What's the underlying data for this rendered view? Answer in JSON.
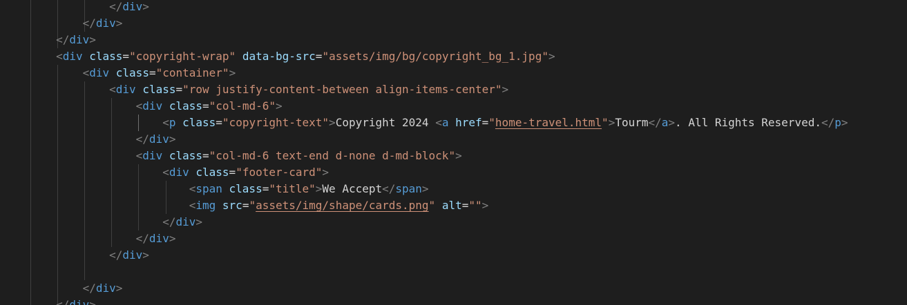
{
  "editor": {
    "theme_colors": {
      "background": "#1e1e1e",
      "tag_bracket": "#808080",
      "tag_name": "#569cd6",
      "attribute": "#9cdcfe",
      "string": "#ce9178",
      "text": "#d4d4d4"
    },
    "lines": [
      {
        "indent": "            ",
        "text": "</div>"
      },
      {
        "indent": "        ",
        "text": "</div>"
      },
      {
        "indent": "    ",
        "text": "</div>"
      },
      {
        "indent": "    ",
        "text": "<div class=\"copyright-wrap\" data-bg-src=\"assets/img/bg/copyright_bg_1.jpg\">"
      },
      {
        "indent": "        ",
        "text": "<div class=\"container\">"
      },
      {
        "indent": "            ",
        "text": "<div class=\"row justify-content-between align-items-center\">"
      },
      {
        "indent": "                ",
        "text": "<div class=\"col-md-6\">"
      },
      {
        "indent": "                    ",
        "text": "<p class=\"copyright-text\">Copyright 2024 <a href=\"home-travel.html\">Tourm</a>. All Rights Reserved.</p>"
      },
      {
        "indent": "                ",
        "text": "</div>"
      },
      {
        "indent": "                ",
        "text": "<div class=\"col-md-6 text-end d-none d-md-block\">"
      },
      {
        "indent": "                    ",
        "text": "<div class=\"footer-card\">"
      },
      {
        "indent": "                        ",
        "text": "<span class=\"title\">We Accept</span>"
      },
      {
        "indent": "                        ",
        "text": "<img src=\"assets/img/shape/cards.png\" alt=\"\">"
      },
      {
        "indent": "                    ",
        "text": "</div>"
      },
      {
        "indent": "                ",
        "text": "</div>"
      },
      {
        "indent": "            ",
        "text": "</div>"
      },
      {
        "indent": "",
        "text": ""
      },
      {
        "indent": "        ",
        "text": "</div>"
      },
      {
        "indent": "    ",
        "text": "</div>"
      }
    ]
  },
  "code": {
    "close_div": "div",
    "open_div": "div",
    "attr_class": "class",
    "attr_data_bg_src": "data-bg-src",
    "attr_href": "href",
    "attr_src": "src",
    "attr_alt": "alt",
    "tag_p": "p",
    "tag_a": "a",
    "tag_span": "span",
    "tag_img": "img",
    "val_copyright_wrap": "\"copyright-wrap\"",
    "val_bg_src": "\"assets/img/bg/copyright_bg_1.jpg\"",
    "val_container": "\"container\"",
    "val_row": "\"row justify-content-between align-items-center\"",
    "val_col_md_6": "\"col-md-6\"",
    "val_copyright_text": "\"copyright-text\"",
    "val_href_open": "\"",
    "val_href_link": "home-travel.html",
    "val_href_close": "\"",
    "text_copyright": "Copyright 2024 ",
    "text_tourm": "Tourm",
    "text_rights": ". All Rights Reserved.",
    "val_col_md_6_text_end": "\"col-md-6 text-end d-none d-md-block\"",
    "val_footer_card": "\"footer-card\"",
    "val_title": "\"title\"",
    "text_we_accept": "We Accept",
    "val_src_open": "\"",
    "val_src_link": "assets/img/shape/cards.png",
    "val_src_close": "\"",
    "val_alt": "\"\""
  }
}
